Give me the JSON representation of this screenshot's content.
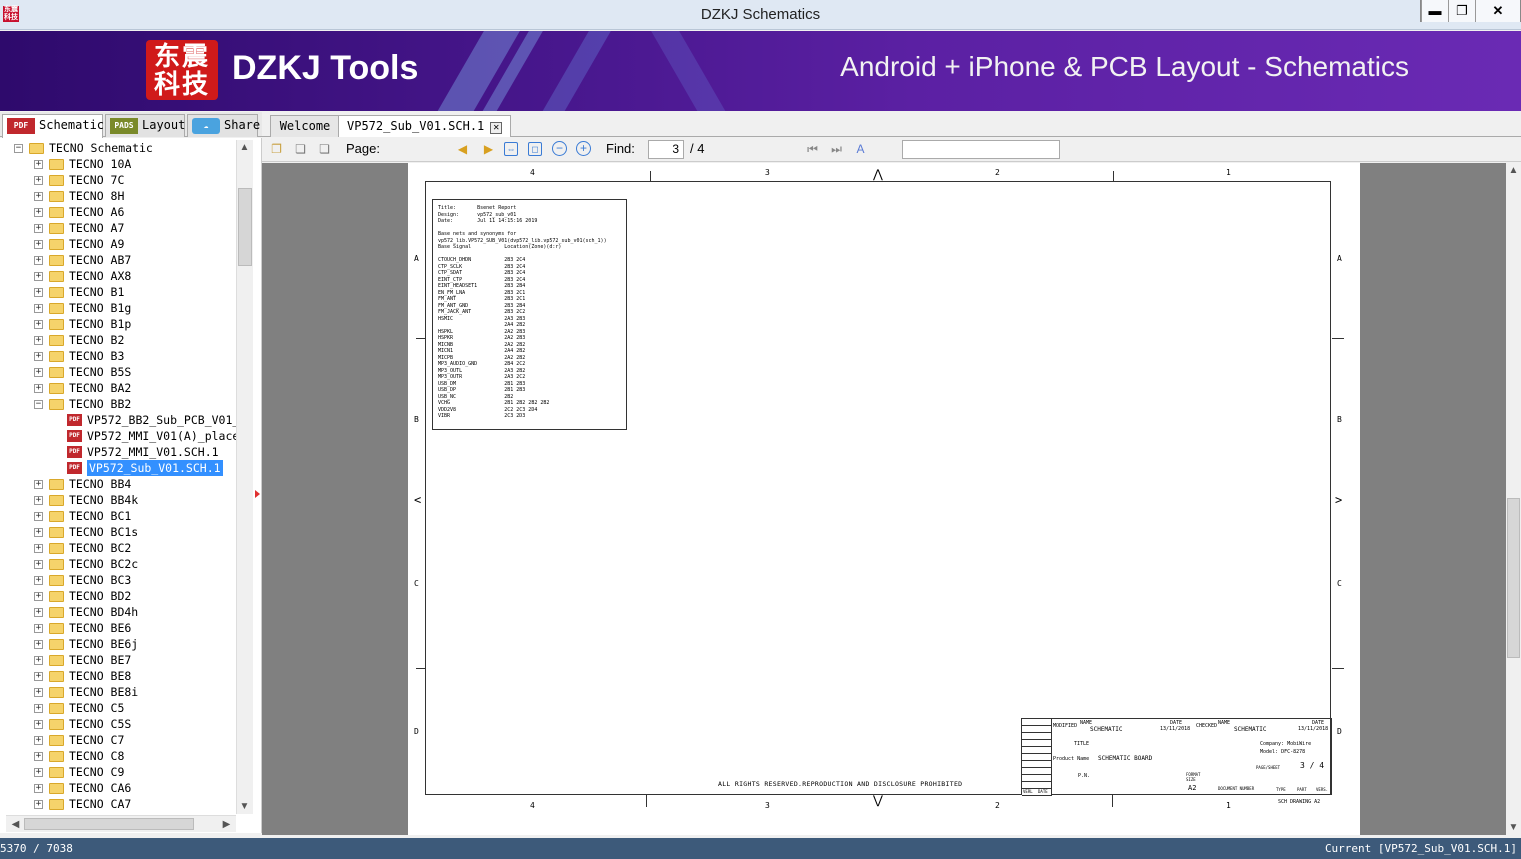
{
  "window": {
    "title": "DZKJ Schematics",
    "icon": "app-logo-icon",
    "min": "▬",
    "max": "❐",
    "close": "✕"
  },
  "banner": {
    "logo_line1": "东震",
    "logo_line2": "科技",
    "brand": "DZKJ Tools",
    "tagline": "Android + iPhone & PCB Layout - Schematics"
  },
  "left_tabs": [
    {
      "icon": "PDF",
      "label": "Schematic"
    },
    {
      "icon": "PADS",
      "label": "Layout"
    },
    {
      "icon": "share-icon",
      "label": "Share"
    }
  ],
  "doc_tabs": [
    {
      "label": "Welcome"
    },
    {
      "label": "VP572_Sub_V01.SCH.1"
    }
  ],
  "tree": {
    "root": "TECNO Schematic",
    "items": [
      {
        "label": "TECNO 10A"
      },
      {
        "label": "TECNO 7C"
      },
      {
        "label": "TECNO 8H"
      },
      {
        "label": "TECNO A6"
      },
      {
        "label": "TECNO A7"
      },
      {
        "label": "TECNO A9"
      },
      {
        "label": "TECNO AB7"
      },
      {
        "label": "TECNO AX8"
      },
      {
        "label": "TECNO B1"
      },
      {
        "label": "TECNO B1g"
      },
      {
        "label": "TECNO B1p"
      },
      {
        "label": "TECNO B2"
      },
      {
        "label": "TECNO B3"
      },
      {
        "label": "TECNO B5S"
      },
      {
        "label": "TECNO BA2"
      },
      {
        "label": "TECNO BB2",
        "expanded": true,
        "children": [
          {
            "label": "VP572_BB2_Sub_PCB_V01_pla"
          },
          {
            "label": "VP572_MMI_V01(A)_placemer"
          },
          {
            "label": "VP572_MMI_V01.SCH.1"
          },
          {
            "label": "VP572_Sub_V01.SCH.1",
            "selected": true
          }
        ]
      },
      {
        "label": "TECNO BB4"
      },
      {
        "label": "TECNO BB4k"
      },
      {
        "label": "TECNO BC1"
      },
      {
        "label": "TECNO BC1s"
      },
      {
        "label": "TECNO BC2"
      },
      {
        "label": "TECNO BC2c"
      },
      {
        "label": "TECNO BC3"
      },
      {
        "label": "TECNO BD2"
      },
      {
        "label": "TECNO BD4h"
      },
      {
        "label": "TECNO BE6"
      },
      {
        "label": "TECNO BE6j"
      },
      {
        "label": "TECNO BE7"
      },
      {
        "label": "TECNO BE8"
      },
      {
        "label": "TECNO BE8i"
      },
      {
        "label": "TECNO C5"
      },
      {
        "label": "TECNO C5S"
      },
      {
        "label": "TECNO C7"
      },
      {
        "label": "TECNO C8"
      },
      {
        "label": "TECNO C9"
      },
      {
        "label": "TECNO CA6"
      },
      {
        "label": "TECNO CA7"
      }
    ]
  },
  "toolbar": {
    "page_label": "Page:",
    "page_value": "3",
    "page_total": "/ 4",
    "find_label": "Find:",
    "find_value": ""
  },
  "sheet": {
    "zones_top": [
      "4",
      "3",
      "2",
      "1"
    ],
    "zones_side": [
      "A",
      "B",
      "C",
      "D"
    ],
    "netlist": "Title:       Bsenet Report\nDesign:      vp572_sub_v01\nDate:        Jul 11 14:15:16 2019\n\nBase nets and synonyms for\nvp572_lib.VP572_SUB_V01(dvp572_lib.vp572_sub_v01(sch_1))\nBase Signal           Location(Zone)(d:r)\n\nCTOUCH_DHDN           2B3 2C4\nCTP_SCLK              2B3 2C4\nCTP_SDAT              2B3 2C4\nEINT_CTP              2B3 2C4\nEINT_HEADSET1         2B3 2B4\nEN_FM_LNA             2B3 2C1\nFM_ANT                2B3 2C1\nFM_ANT_GND            2B3 2B4\nFM_JACK_ANT           2B3 2C2\nHSMIC                 2A3 2B3\n                      2A4 2B2\nHSPKL                 2A2 2B3\nHSPKR                 2A2 2B3\nMICNB                 2A2 2B2\nMICN1                 2A4 2B2\nMICPB                 2A2 2B2\nMP3_AUDIO_GND         2B4 2C2\nMP3_OUTL              2A3 2B2\nMP3_OUTR              2A3 2C2\nUSB_DM                2B1 2B3\nUSB_DP                2B1 2B3\nUSB_NC                2B2\nVCHG                  2B1 2B2 2B2 2B2\nVDD2V8                2C2 2C3 2D4\nVIBR                  2C3 2D3",
    "rights": "ALL RIGHTS RESERVED.REPRODUCTION AND DISCLOSURE PROHIBITED",
    "title_block": {
      "name1": "SCHEMATIC",
      "date1": "13/11/2018",
      "name2": "SCHEMATIC",
      "date2": "13/11/2018",
      "product": "SCHEMATIC BOARD",
      "company": "Company: MobiWire",
      "model": "Model: DFC-8278",
      "sheet": "3 / 4",
      "format": "A2",
      "drawing": "SCH DRAWING A2",
      "modified": "MODIFIED",
      "checked": "CHECKED",
      "name_lbl": "NAME",
      "date_lbl": "DATE",
      "title_lbl": "TITLE",
      "product_lbl": "Product Name",
      "pn_lbl": "P.N.",
      "page_lbl": "PAGE/SHEET",
      "format_lbl": "FORMAT SIZE",
      "docnum_lbl": "DOCUMENT NUMBER",
      "type_lbl": "TYPE",
      "part_lbl": "PART",
      "ver_lbl": "VERS.",
      "verl_lbl": "VERL",
      "date_small": "DATE"
    }
  },
  "status": {
    "left": "5370 / 7038",
    "right": "Current [VP572_Sub_V01.SCH.1]"
  },
  "colors": {
    "banner": "#4a1890",
    "selection": "#3390ff",
    "status": "#3d5a7a"
  }
}
